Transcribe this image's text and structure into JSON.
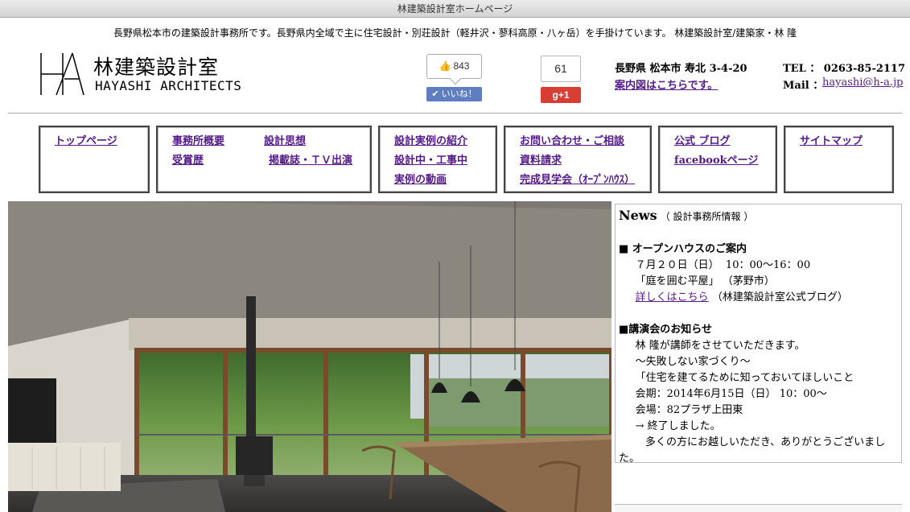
{
  "window": {
    "title": "林建築設計室ホームページ"
  },
  "header": {
    "tagline": "長野県松本市の建築設計事務所です。長野県内全域で主に住宅設計・別荘設計（軽井沢・蓼科高原・八ヶ岳）を手掛けています。 林建築設計室/建築家・林 隆",
    "logo_mark": "HA",
    "logo_jp": "林建築設計室",
    "logo_en": "HAYASHI ARCHITECTS"
  },
  "social": {
    "fb_count": "843",
    "fb_like_label": "✔ いいね！",
    "gplus_count": "61",
    "gplus_label": "g+1"
  },
  "contact": {
    "address": "長野県 松本市 寿北 3-4-20",
    "map_link": "案内図はこちらです。",
    "tel": "TEL ： 0263-85-2117",
    "mail_label": "Mail ：",
    "mail": "hayashi@h-a.jp"
  },
  "nav": {
    "top": "トップページ",
    "about": "事務所概要",
    "philosophy": "設計思想",
    "awards": "受賞歴",
    "media": "掲載誌・ＴＶ出演",
    "works": "設計実例の紹介",
    "in_progress": "設計中・工事中",
    "videos": "実例の動画",
    "contact": "お問い合わせ・ご相談",
    "materials": "資料請求",
    "openhouse": "完成見学会（ｵｰﾌﾟﾝﾊｳｽ）",
    "blog": "公式 ブログ",
    "facebook": "facebookページ",
    "sitemap": "サイトマップ"
  },
  "news": {
    "heading": "News",
    "subheading": "（ 設計事務所情報 ）",
    "item1_title": "■ オープンハウスのご案内",
    "item1_date": "     ７月２０日（日）  10：00～16：00",
    "item1_name": "     「庭を囲む平屋」 （茅野市）",
    "item1_link": "詳しくはこちら",
    "item1_link_note": " （林建築設計室公式ブログ）",
    "item2_title": "■講演会のお知らせ",
    "item2_line1": "     林 隆が講師をさせていただきます。",
    "item2_line2": "     ～失敗しない家づくり～",
    "item2_line3": "     「住宅を建てるために知っておいてほしいこと",
    "item2_line4": "     会期：2014年6月15日（日） 10：00～",
    "item2_line5": "     会場：82プラザ上田東",
    "item2_line6": "     → 終了しました。",
    "item2_line7": "        多くの方にお越しいただき、ありがとうございまし",
    "item2_line8": "た。"
  },
  "colors": {
    "link": "#551a8b",
    "facebook": "#5f7ec1",
    "gplus": "#d73d32"
  }
}
